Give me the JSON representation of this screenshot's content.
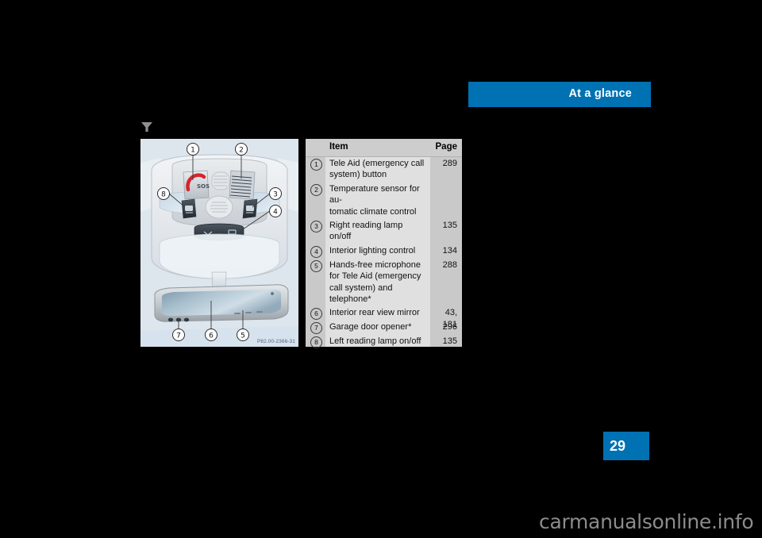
{
  "running_head": {
    "title": "At a glance",
    "bar_color": "#0071b3"
  },
  "marker_icon": {
    "name": "funnel-triangle-icon",
    "color": "#8f8f8f"
  },
  "illustration": {
    "figure_code": "P82.00-2366-31",
    "background": "#dde5ed",
    "callouts": [
      "1",
      "2",
      "3",
      "4",
      "5",
      "6",
      "7",
      "8"
    ],
    "description": "Overhead control panel and interior rear view mirror"
  },
  "legend": {
    "headers": {
      "item": "Item",
      "page": "Page"
    },
    "rows": [
      {
        "marker": "1",
        "label": "Tele Aid (emergency call system) button",
        "page": "289"
      },
      {
        "marker": "2",
        "label": "Temperature sensor for au-tomatic climate control",
        "page": ""
      },
      {
        "marker": "3",
        "label": "Right reading lamp on/off",
        "page": "135"
      },
      {
        "marker": "4",
        "label": "Interior lighting control",
        "page": "134"
      },
      {
        "marker": "5",
        "label": "Hands-free microphone for Tele Aid (emergency call system) and telephone*",
        "page": "288"
      },
      {
        "marker": "6",
        "label": "Interior rear view mirror",
        "page": "43,\n181"
      },
      {
        "marker": "7",
        "label": "Garage door opener*",
        "page": "296"
      },
      {
        "marker": "8",
        "label": "Left reading lamp on/off",
        "page": "135"
      }
    ]
  },
  "page_number": "29",
  "watermark": "carmanualsonline.info"
}
